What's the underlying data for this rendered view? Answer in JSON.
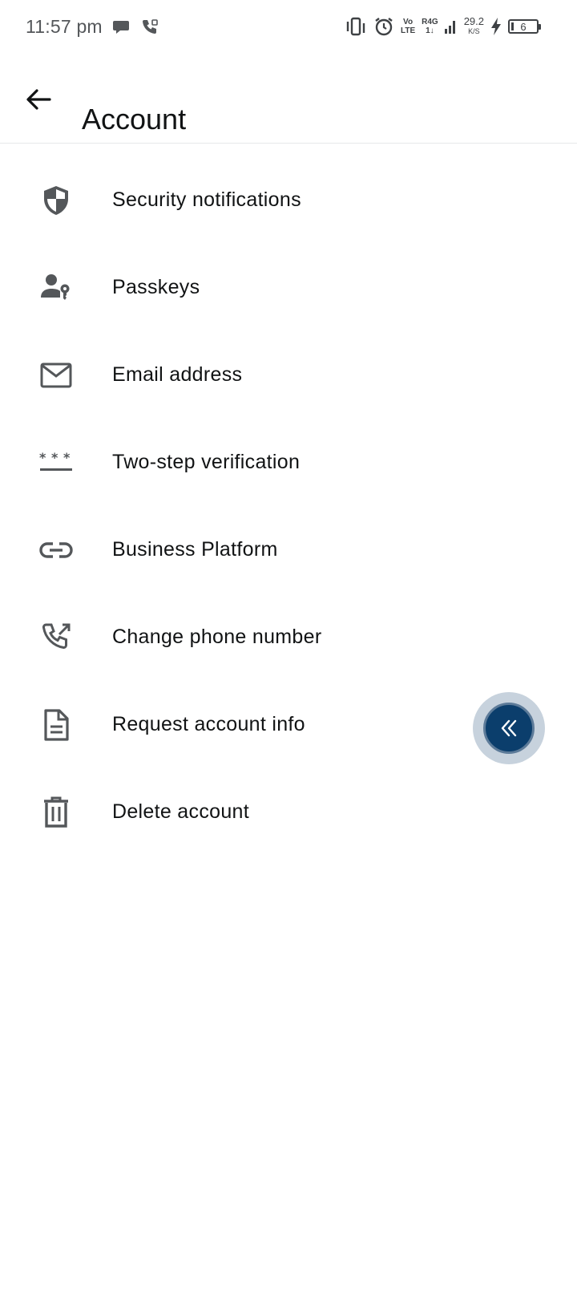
{
  "status_bar": {
    "time": "11:57 pm",
    "volte_top": "Vo",
    "volte_bottom": "LTE",
    "network_top": "R4G",
    "network_bottom": "1↓",
    "speed_value": "29.2",
    "speed_unit": "K/S",
    "battery_level": "6"
  },
  "app_bar": {
    "title": "Account"
  },
  "menu": {
    "items": [
      {
        "label": "Security notifications",
        "icon": "shield-icon"
      },
      {
        "label": "Passkeys",
        "icon": "person-key-icon"
      },
      {
        "label": "Email address",
        "icon": "envelope-icon"
      },
      {
        "label": "Two-step verification",
        "icon": "password-dots-icon"
      },
      {
        "label": "Business Platform",
        "icon": "link-icon"
      },
      {
        "label": "Change phone number",
        "icon": "phone-forward-icon"
      },
      {
        "label": "Request account info",
        "icon": "document-icon"
      },
      {
        "label": "Delete account",
        "icon": "trash-icon"
      }
    ]
  },
  "colors": {
    "icon_gray": "#54575a",
    "text": "#111314",
    "float_button": "#0b3e6c",
    "float_ring": "#c7d2dd"
  },
  "floating_button": {
    "icon": "double-chevron-left-icon"
  }
}
